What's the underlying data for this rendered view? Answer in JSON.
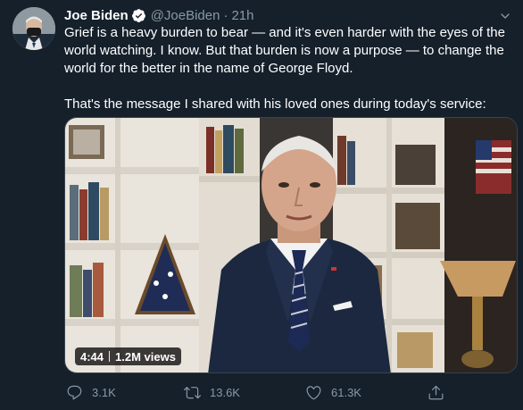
{
  "author": {
    "name": "Joe Biden",
    "handle": "@JoeBiden",
    "separator": "·",
    "time": "21h",
    "verified": true
  },
  "tweet": {
    "paragraph1": "Grief is a heavy burden to bear — and it's even harder with the eyes of the world watching. I know. But that burden is now a purpose — to change the world for the better in the name of George Floyd.",
    "paragraph2": "That's the message I shared with his loved ones during today's service:"
  },
  "video": {
    "duration": "4:44",
    "views": "1.2M views"
  },
  "actions": {
    "replies": "3.1K",
    "retweets": "13.6K",
    "likes": "61.3K"
  },
  "colors": {
    "background": "#15202b",
    "text": "#ffffff",
    "muted": "#8899a6",
    "verified": "#ffffff"
  },
  "icons": [
    "verified-badge-icon",
    "chevron-down-icon",
    "reply-icon",
    "retweet-icon",
    "like-icon",
    "share-icon"
  ]
}
